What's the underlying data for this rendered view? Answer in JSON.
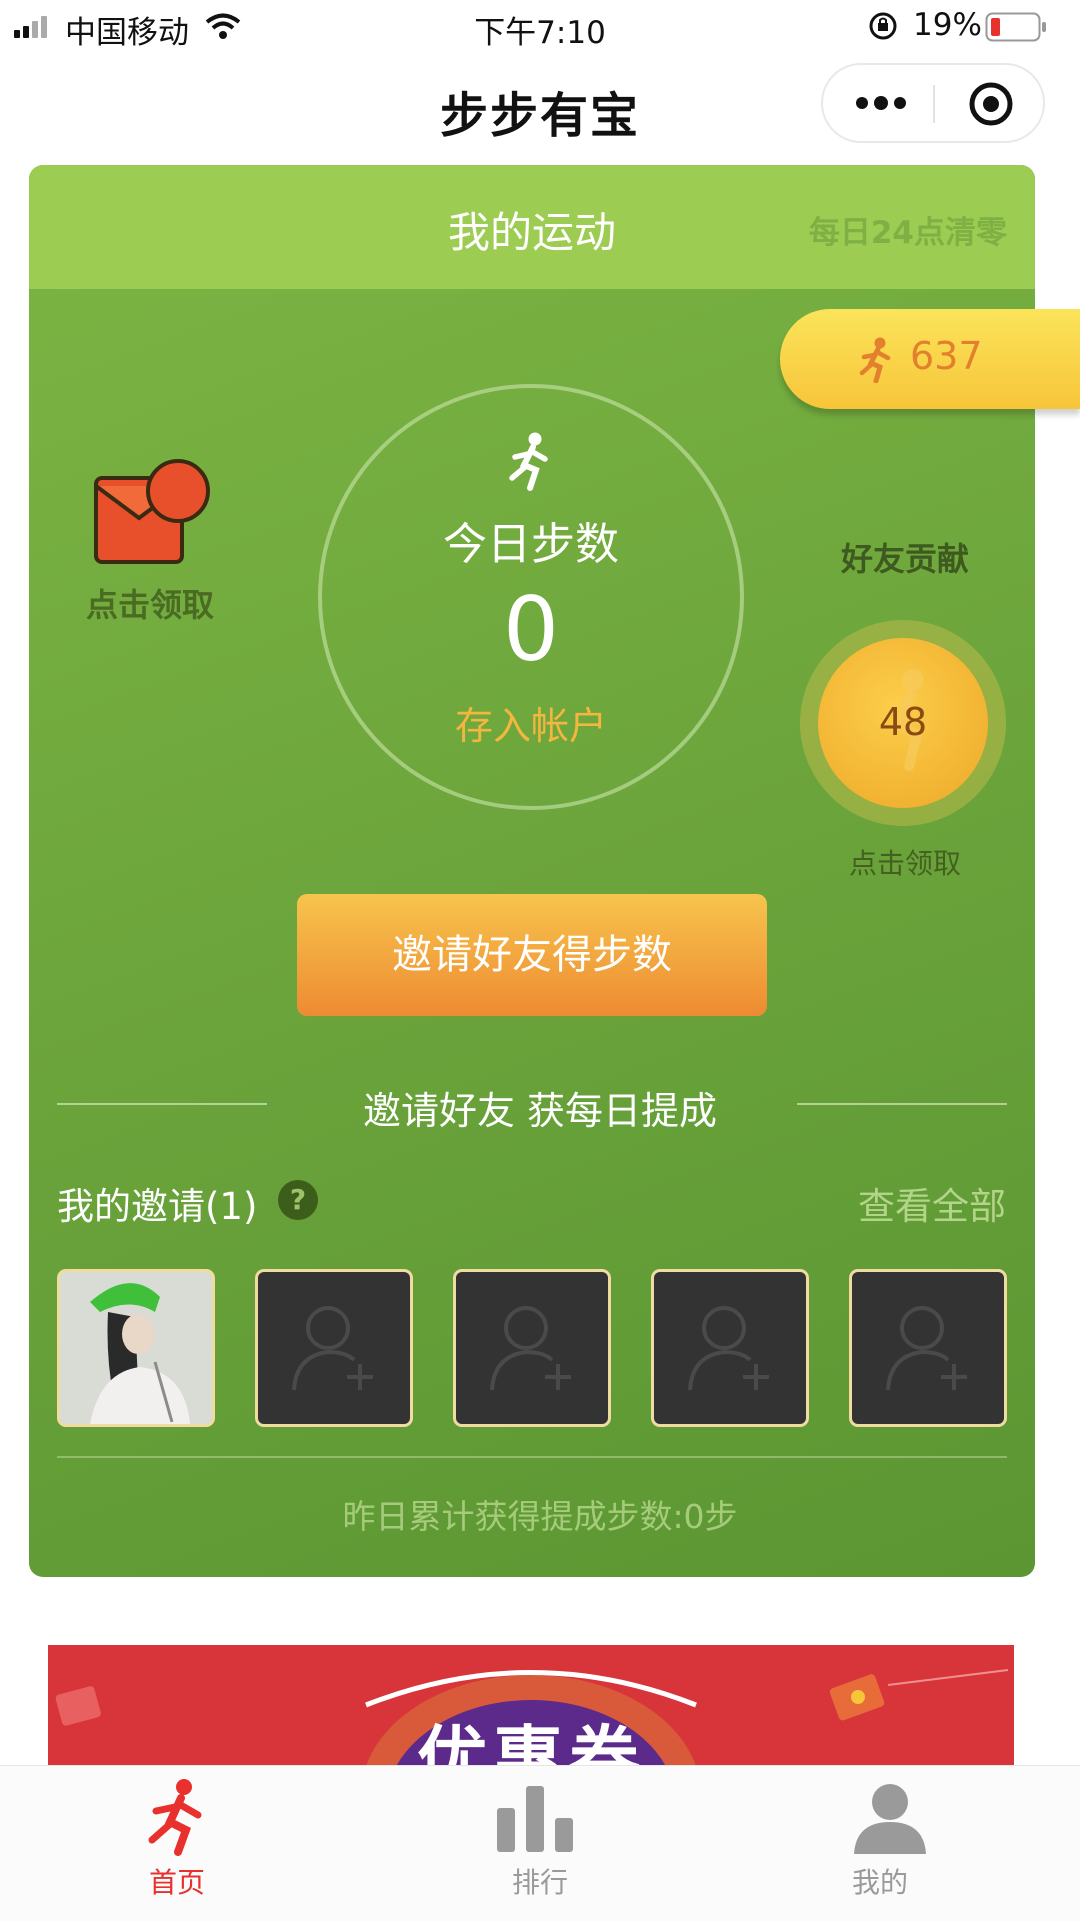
{
  "status_bar": {
    "carrier": "中国移动",
    "time": "下午7:10",
    "battery": "19%"
  },
  "nav": {
    "title": "步步有宝"
  },
  "card": {
    "title": "我的运动",
    "reset_note": "每日24点清零",
    "pill_steps": "637",
    "today_label": "今日步数",
    "today_value": "0",
    "deposit_label": "存入帐户",
    "envelope_label": "点击领取",
    "friend_title": "好友贡献",
    "friend_value": "48",
    "friend_claim_label": "点击领取",
    "invite_button": "邀请好友得步数",
    "invite_subtitle": "邀请好友 获每日提成",
    "my_invites": "我的邀请(1)",
    "help_symbol": "?",
    "view_all": "查看全部",
    "yesterday_text": "昨日累计获得提成步数:0步"
  },
  "banner": {
    "text": "优惠券"
  },
  "tabbar": {
    "tabs": [
      {
        "label": "首页",
        "active": true
      },
      {
        "label": "排行",
        "active": false
      },
      {
        "label": "我的",
        "active": false
      }
    ]
  },
  "colors": {
    "card_green": "#6aa33a",
    "header_green": "#9dcc53",
    "accent_orange": "#ee8b33",
    "active_red": "#e8302c",
    "inactive_gray": "#9a9a9a"
  }
}
